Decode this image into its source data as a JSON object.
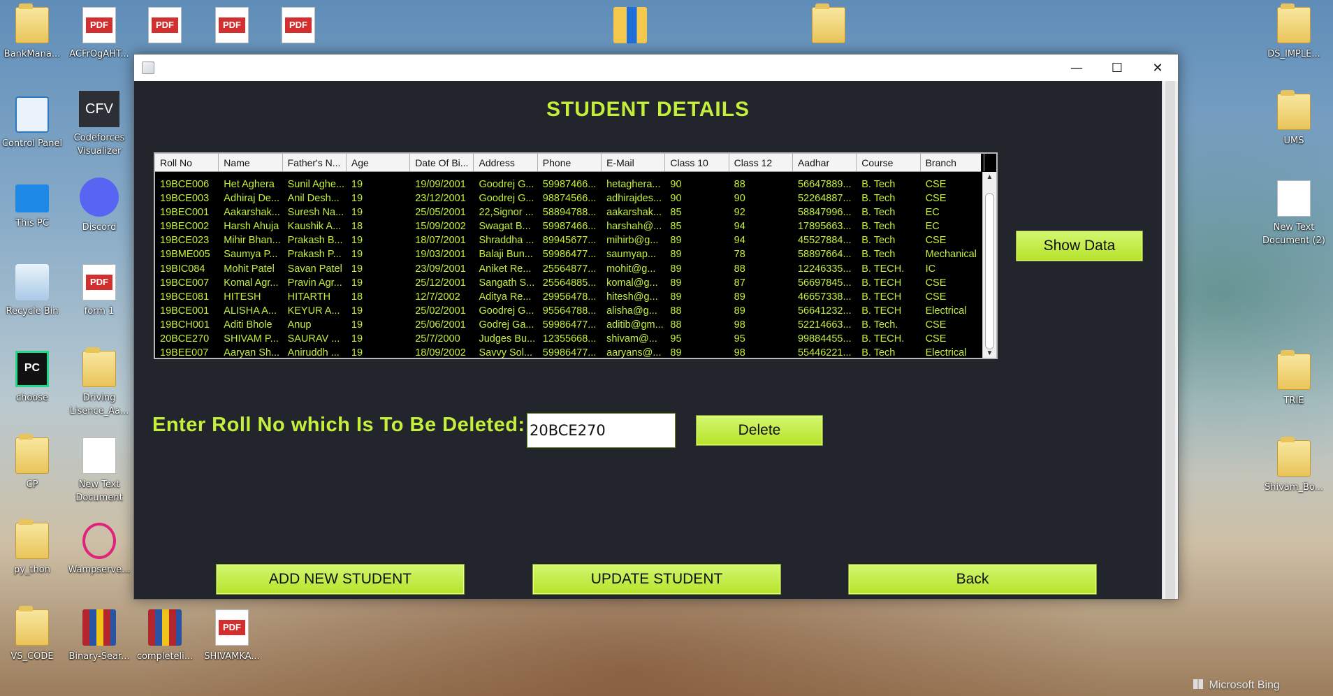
{
  "desktop": {
    "left_icons": [
      {
        "label": "BankMana...",
        "kind": "folder"
      },
      {
        "label": "ACFrOgAHT...",
        "kind": "pdf"
      },
      {
        "label": "",
        "kind": "pdf"
      },
      {
        "label": "",
        "kind": "pdf"
      },
      {
        "label": "",
        "kind": "pdf"
      },
      {
        "label": "Control Panel",
        "kind": "control-panel"
      },
      {
        "label": "Codeforces Visualizer",
        "kind": "cfv"
      },
      {
        "label": "This PC",
        "kind": "monitor"
      },
      {
        "label": "Discord",
        "kind": "discord"
      },
      {
        "label": "Recycle Bin",
        "kind": "bin"
      },
      {
        "label": "form 1",
        "kind": "pdf"
      },
      {
        "label": "choose",
        "kind": "pycharm"
      },
      {
        "label": "Driving Lisence_Aa...",
        "kind": "folder"
      },
      {
        "label": "CP",
        "kind": "folder"
      },
      {
        "label": "New Text Document",
        "kind": "doc"
      },
      {
        "label": "py_thon",
        "kind": "folder"
      },
      {
        "label": "Wampserve...",
        "kind": "wamp"
      },
      {
        "label": "VS_CODE",
        "kind": "folder"
      },
      {
        "label": "Binary-Sear...",
        "kind": "rar"
      },
      {
        "label": "completeli...",
        "kind": "rar"
      },
      {
        "label": "SHIVAMKA...",
        "kind": "pdf"
      }
    ],
    "right_icons": [
      {
        "label": "DS_IMPLE...",
        "kind": "folder"
      },
      {
        "label": "UMS",
        "kind": "folder"
      },
      {
        "label": "New Text Document (2)",
        "kind": "doc"
      },
      {
        "label": "TRIE",
        "kind": "folder"
      },
      {
        "label": "Shivam_Bo...",
        "kind": "folder"
      }
    ],
    "watermark": "Microsoft Bing",
    "pdf_badge": "PDF",
    "cfv_badge": "CFV",
    "pc_badge": "PC"
  },
  "window": {
    "controls": {
      "minimize": "—",
      "maximize": "☐",
      "close": "✕"
    },
    "title": "STUDENT DETAILS",
    "table": {
      "columns": [
        "Roll No",
        "Name",
        "Father's N...",
        "Age",
        "Date Of Bi...",
        "Address",
        "Phone",
        "E-Mail",
        "Class 10",
        "Class 12",
        "Aadhar",
        "Course",
        "Branch"
      ],
      "partial_row": [
        "",
        "",
        "",
        "",
        "",
        "",
        "",
        "",
        "",
        "",
        "",
        "",
        ""
      ],
      "rows": [
        [
          "19BCE006",
          "Het Aghera",
          "Sunil Aghe...",
          "19",
          "19/09/2001",
          "Goodrej G...",
          "59987466...",
          "hetaghera...",
          "90",
          "88",
          "56647889...",
          "B. Tech",
          "CSE"
        ],
        [
          "19BCE003",
          "Adhiraj De...",
          "Anil Desh...",
          "19",
          "23/12/2001",
          "Goodrej G...",
          "98874566...",
          "adhirajdes...",
          "90",
          "90",
          "52264887...",
          "B. Tech",
          "CSE"
        ],
        [
          "19BEC001",
          "Aakarshak...",
          "Suresh Na...",
          "19",
          "25/05/2001",
          "22,Signor ...",
          "58894788...",
          "aakarshak...",
          "85",
          "92",
          "58847996...",
          "B. Tech",
          "EC"
        ],
        [
          "19BEC002",
          "Harsh Ahuja",
          "Kaushik A...",
          "18",
          "15/09/2002",
          "Swagat B...",
          "59987466...",
          "harshah@...",
          "85",
          "94",
          "17895663...",
          "B. Tech",
          "EC"
        ],
        [
          "19BCE023",
          "Mihir Bhan...",
          "Prakash B...",
          "19",
          "18/07/2001",
          "Shraddha ...",
          "89945677...",
          "mihirb@g...",
          "89",
          "94",
          "45527884...",
          "B. Tech",
          "CSE"
        ],
        [
          "19BME005",
          "Saumya P...",
          "Prakash P...",
          "19",
          "19/03/2001",
          "Balaji Bun...",
          "59986477...",
          "saumyap...",
          "89",
          "78",
          "58897664...",
          "B. Tech",
          "Mechanical"
        ],
        [
          "19BIC084",
          "Mohit Patel",
          "Savan Patel",
          "19",
          "23/09/2001",
          "Aniket Re...",
          "25564877...",
          "mohit@g...",
          "89",
          "88",
          "12246335...",
          "B. TECH.",
          "IC"
        ],
        [
          "19BCE007",
          "Komal Agr...",
          "Pravin Agr...",
          "19",
          "25/12/2001",
          "Sangath S...",
          "25564885...",
          "komal@g...",
          "89",
          "87",
          "56697845...",
          "B. TECH",
          "CSE"
        ],
        [
          "19BCE081",
          "HITESH",
          "HITARTH",
          "18",
          "12/7/2002",
          "Aditya Re...",
          "29956478...",
          "hitesh@g...",
          "89",
          "89",
          "46657338...",
          "B. TECH",
          "CSE"
        ],
        [
          "19BCE001",
          "ALISHA A...",
          "KEYUR A...",
          "19",
          "25/02/2001",
          "Goodrej G...",
          "95564788...",
          "alisha@g...",
          "88",
          "89",
          "56641232...",
          "B. TECH",
          "Electrical"
        ],
        [
          "19BCH001",
          "Aditi Bhole",
          "Anup",
          "19",
          "25/06/2001",
          "Godrej Ga...",
          "59986477...",
          "aditib@gm...",
          "88",
          "98",
          "52214663...",
          "B. Tech.",
          "CSE"
        ],
        [
          "20BCE270",
          "SHIVAM P...",
          "SAURAV ...",
          "19",
          "25/7/2000",
          "Judges Bu...",
          "12355668...",
          "shivam@...",
          "95",
          "95",
          "99884455...",
          "B. TECH.",
          "CSE"
        ],
        [
          "19BEE007",
          "Aaryan Sh...",
          "Aniruddh ...",
          "19",
          "18/09/2002",
          "Savvy Sol...",
          "59986477...",
          "aaryans@...",
          "89",
          "98",
          "55446221...",
          "B. Tech",
          "Electrical"
        ]
      ]
    },
    "show_data_label": "Show Data",
    "prompt_label": "Enter Roll No which Is To Be Deleted:",
    "roll_input_value": "20BCE270",
    "delete_label": "Delete",
    "add_label": "ADD NEW STUDENT",
    "update_label": "UPDATE STUDENT",
    "back_label": "Back"
  },
  "colors": {
    "accent": "#c4ef3b",
    "panel_bg": "#23252d",
    "button": "#b6e32a"
  }
}
